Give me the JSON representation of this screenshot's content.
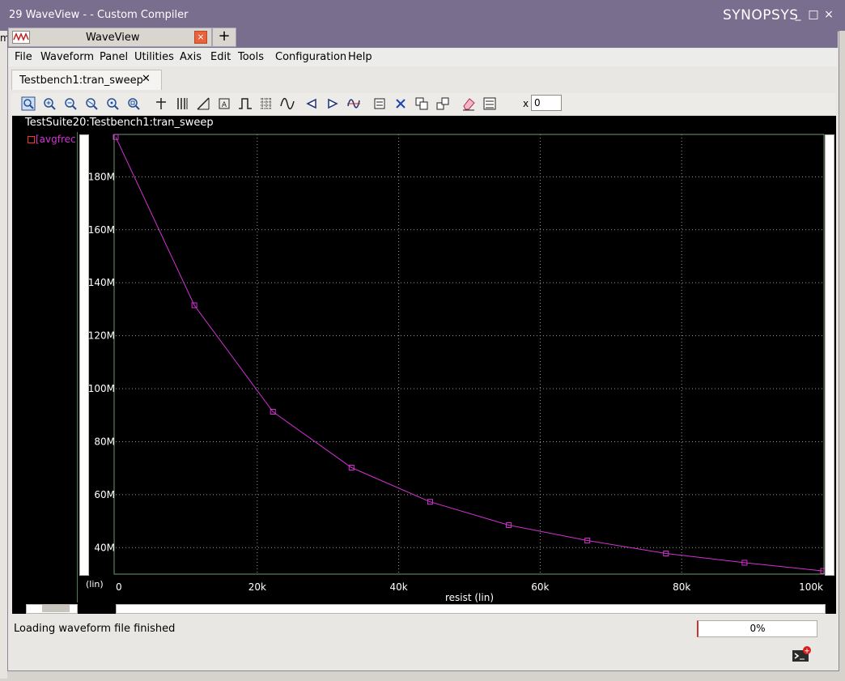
{
  "window": {
    "title": "29 WaveView -  - Custom Compiler",
    "brand": "SYNOPSYS",
    "controls": [
      "_",
      "□",
      "×"
    ]
  },
  "background_fragment": "m",
  "app_tab": {
    "label": "WaveView",
    "close": "×",
    "new_tab": "+"
  },
  "menu": [
    "File",
    "Waveform",
    "Panel",
    "Utilities",
    "Axis",
    "Edit",
    "Tools",
    "Configuration",
    "Help"
  ],
  "doc_tab": {
    "label": "Testbench1:tran_sweep",
    "close": "✕"
  },
  "toolbar": {
    "icons": [
      "zoom-fit-icon",
      "zoom-in-icon",
      "zoom-out-icon",
      "zoom-x-icon",
      "zoom-y-icon",
      "zoom-area-icon",
      "cursor-cross-icon",
      "bars-icon",
      "measure-icon",
      "marker-icon",
      "step-icon",
      "grid-icon",
      "wave-icon",
      "prev-icon",
      "next-icon",
      "stack-icon",
      "tile-icon",
      "delete-icon",
      "copy-icon",
      "link-icon",
      "eraser-icon",
      "properties-icon"
    ],
    "x_label": "x",
    "x_value": "0"
  },
  "panel_title": "TestSuite20:Testbench1:tran_sweep",
  "signal": {
    "label": "[avgfrec",
    "color": "#d431d4"
  },
  "y_axis_scale_label": "(lin)",
  "status": {
    "message": "Loading waveform file finished",
    "progress": "0%"
  },
  "chart_data": {
    "type": "line",
    "xlabel": "resist (lin)",
    "ylabel": "",
    "x_ticks": [
      "0",
      "20k",
      "40k",
      "60k",
      "80k",
      "100k"
    ],
    "y_ticks": [
      "40M",
      "60M",
      "80M",
      "100M",
      "120M",
      "140M",
      "160M",
      "180M"
    ],
    "xlim": [
      0,
      100000
    ],
    "ylim": [
      30000000,
      196000000
    ],
    "grid": true,
    "marker": "square",
    "series": [
      {
        "name": "[avgfrec",
        "color": "#d431d4",
        "x": [
          0,
          11111,
          22222,
          33333,
          44444,
          55556,
          66667,
          77778,
          88889,
          100000
        ],
        "y": [
          195000000,
          131500000,
          91300000,
          70200000,
          57300000,
          48500000,
          42700000,
          37800000,
          34300000,
          31200000
        ]
      }
    ]
  }
}
